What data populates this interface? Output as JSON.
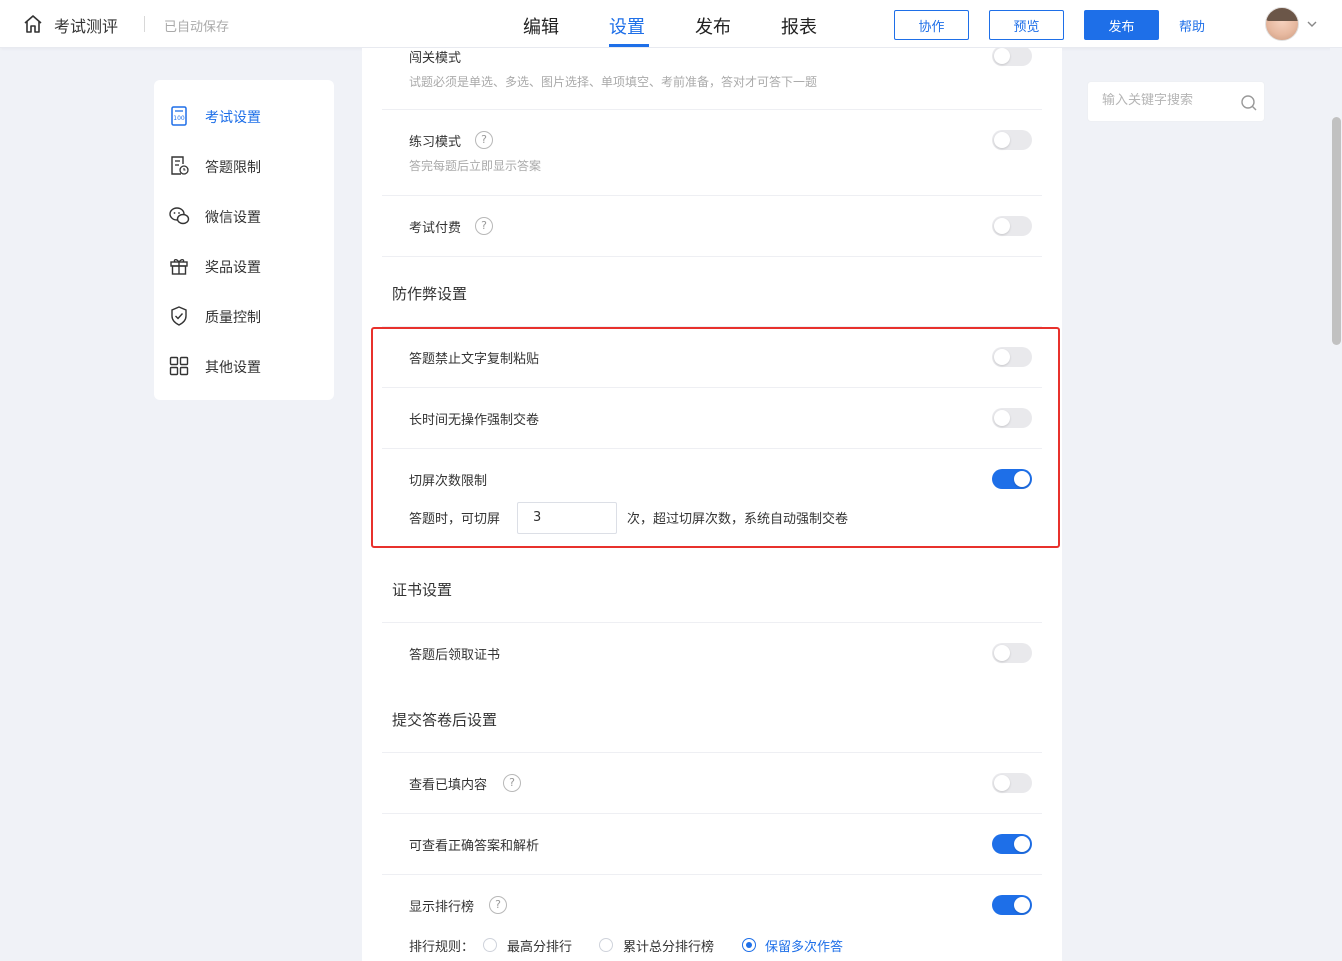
{
  "header": {
    "app_title": "考试测评",
    "autosave": "已自动保存",
    "tabs": [
      {
        "label": "编辑",
        "active": false
      },
      {
        "label": "设置",
        "active": true
      },
      {
        "label": "发布",
        "active": false
      },
      {
        "label": "报表",
        "active": false
      }
    ],
    "collab_label": "协作",
    "preview_label": "预览",
    "publish_label": "发布",
    "help_label": "帮助",
    "accent_color": "#1e6fe8"
  },
  "sidebar": {
    "items": [
      {
        "label": "考试设置",
        "icon": "exam-paper-icon",
        "active": true
      },
      {
        "label": "答题限制",
        "icon": "answer-limit-icon",
        "active": false
      },
      {
        "label": "微信设置",
        "icon": "wechat-icon",
        "active": false
      },
      {
        "label": "奖品设置",
        "icon": "gift-icon",
        "active": false
      },
      {
        "label": "质量控制",
        "icon": "shield-icon",
        "active": false
      },
      {
        "label": "其他设置",
        "icon": "grid-apps-icon",
        "active": false
      }
    ]
  },
  "settings": {
    "level_mode": {
      "label": "闯关模式",
      "desc": "试题必须是单选、多选、图片选择、单项填空、考前准备，答对才可答下一题",
      "enabled": false
    },
    "practice_mode": {
      "label": "练习模式",
      "desc": "答完每题后立即显示答案",
      "enabled": false
    },
    "exam_fee": {
      "label": "考试付费",
      "enabled": false
    },
    "anti_cheat": {
      "title": "防作弊设置",
      "no_copy": {
        "label": "答题禁止文字复制粘贴",
        "enabled": false
      },
      "idle_submit": {
        "label": "长时间无操作强制交卷",
        "enabled": false
      },
      "screen_switch": {
        "label": "切屏次数限制",
        "enabled": true,
        "prefix": "答题时，可切屏",
        "count": "3",
        "suffix": "次，超过切屏次数，系统自动强制交卷"
      }
    },
    "certificate": {
      "title": "证书设置",
      "claim": {
        "label": "答题后领取证书",
        "enabled": false
      }
    },
    "after_submit": {
      "title": "提交答卷后设置",
      "view_filled": {
        "label": "查看已填内容",
        "enabled": false
      },
      "view_answers": {
        "label": "可查看正确答案和解析",
        "enabled": true
      },
      "leaderboard": {
        "label": "显示排行榜",
        "enabled": true
      },
      "rank_rule_label": "排行规则：",
      "rank_options": [
        {
          "label": "最高分排行",
          "checked": false
        },
        {
          "label": "累计总分排行榜",
          "checked": false
        },
        {
          "label": "保留多次作答",
          "checked": true
        }
      ]
    }
  },
  "search": {
    "placeholder": "输入关键字搜索"
  },
  "help_glyph": "?"
}
